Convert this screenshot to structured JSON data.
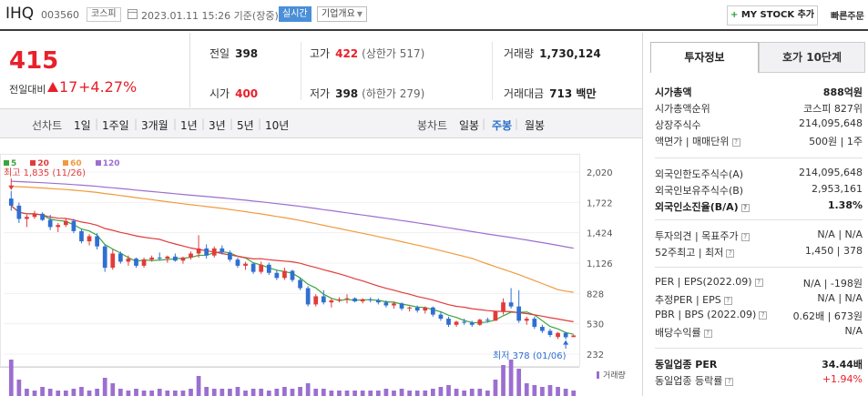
{
  "header": {
    "name": "IHQ",
    "code": "003560",
    "market": "코스피",
    "date_text": "2023.01.11 15:26 기준(장중)",
    "realtime_label": "실시간",
    "corp_label": "기업개요",
    "mystock_plus": "+",
    "mystock_label": "MY STOCK 추가",
    "quick_order": "빠른주문"
  },
  "price": {
    "current": "415",
    "change_label": "전일대비",
    "change_value": "17",
    "change_pct": "+4.27%"
  },
  "summary": {
    "prev_label": "전일",
    "prev": "398",
    "high_label": "고가",
    "high": "422",
    "high_note": "(상한가 517)",
    "volume_label": "거래량",
    "volume": "1,730,124",
    "open_label": "시가",
    "open": "400",
    "low_label": "저가",
    "low": "398",
    "low_note": "(하한가 279)",
    "amount_label": "거래대금",
    "amount": "713 백만"
  },
  "period_bar": {
    "line_label": "선차트",
    "line_periods": [
      "1일",
      "1주일",
      "3개월",
      "1년",
      "3년",
      "5년",
      "10년"
    ],
    "candle_label": "봉차트",
    "candle_periods": [
      "일봉",
      "주봉",
      "월봉"
    ],
    "candle_selected": "주봉"
  },
  "chart_data": {
    "type": "candlestick",
    "interval": "weekly",
    "y_ticks": [
      "2,020",
      "1,722",
      "1,424",
      "1,126",
      "828",
      "530",
      "232"
    ],
    "ylim": [
      232,
      2020
    ],
    "moving_averages": [
      {
        "name": "5",
        "color": "#3aa63a"
      },
      {
        "name": "20",
        "color": "#e23b3b"
      },
      {
        "name": "60",
        "color": "#f09a3e"
      },
      {
        "name": "120",
        "color": "#9b6fd0"
      }
    ],
    "high_annotation": "최고 1,835 (11/26)",
    "low_annotation": "최저 378 (01/06)",
    "volume_label": "거래량",
    "candles": [
      [
        1760,
        1835,
        1640,
        1690
      ],
      [
        1690,
        1720,
        1520,
        1560
      ],
      [
        1560,
        1600,
        1480,
        1580
      ],
      [
        1580,
        1640,
        1560,
        1610
      ],
      [
        1610,
        1625,
        1540,
        1550
      ],
      [
        1550,
        1600,
        1450,
        1480
      ],
      [
        1480,
        1520,
        1430,
        1500
      ],
      [
        1500,
        1560,
        1480,
        1540
      ],
      [
        1540,
        1560,
        1420,
        1440
      ],
      [
        1440,
        1460,
        1320,
        1340
      ],
      [
        1340,
        1410,
        1300,
        1390
      ],
      [
        1390,
        1420,
        1260,
        1290
      ],
      [
        1290,
        1310,
        1040,
        1080
      ],
      [
        1080,
        1260,
        1060,
        1220
      ],
      [
        1220,
        1240,
        1120,
        1140
      ],
      [
        1140,
        1200,
        1100,
        1170
      ],
      [
        1170,
        1180,
        1080,
        1100
      ],
      [
        1100,
        1180,
        1080,
        1160
      ],
      [
        1160,
        1200,
        1140,
        1180
      ],
      [
        1180,
        1230,
        1150,
        1170
      ],
      [
        1170,
        1200,
        1130,
        1190
      ],
      [
        1190,
        1220,
        1140,
        1150
      ],
      [
        1150,
        1190,
        1120,
        1180
      ],
      [
        1180,
        1240,
        1160,
        1220
      ],
      [
        1220,
        1400,
        1180,
        1270
      ],
      [
        1270,
        1310,
        1170,
        1200
      ],
      [
        1200,
        1290,
        1180,
        1270
      ],
      [
        1270,
        1300,
        1210,
        1230
      ],
      [
        1230,
        1250,
        1140,
        1160
      ],
      [
        1160,
        1180,
        1080,
        1100
      ],
      [
        1100,
        1140,
        1060,
        1120
      ],
      [
        1120,
        1130,
        1020,
        1040
      ],
      [
        1040,
        1140,
        1020,
        1110
      ],
      [
        1110,
        1130,
        1010,
        1030
      ],
      [
        1030,
        1060,
        960,
        980
      ],
      [
        980,
        1080,
        960,
        1050
      ],
      [
        1050,
        1060,
        940,
        960
      ],
      [
        960,
        980,
        860,
        880
      ],
      [
        880,
        900,
        700,
        720
      ],
      [
        720,
        820,
        700,
        800
      ],
      [
        800,
        860,
        720,
        740
      ],
      [
        740,
        780,
        690,
        760
      ],
      [
        760,
        790,
        740,
        770
      ],
      [
        770,
        820,
        730,
        780
      ],
      [
        780,
        790,
        740,
        750
      ],
      [
        750,
        780,
        730,
        770
      ],
      [
        770,
        790,
        740,
        760
      ],
      [
        760,
        780,
        720,
        740
      ],
      [
        740,
        760,
        690,
        710
      ],
      [
        710,
        750,
        680,
        730
      ],
      [
        730,
        740,
        660,
        680
      ],
      [
        680,
        700,
        650,
        690
      ],
      [
        690,
        710,
        640,
        660
      ],
      [
        660,
        700,
        630,
        690
      ],
      [
        690,
        700,
        600,
        620
      ],
      [
        620,
        650,
        560,
        580
      ],
      [
        580,
        600,
        500,
        520
      ],
      [
        520,
        560,
        500,
        550
      ],
      [
        550,
        580,
        520,
        540
      ],
      [
        540,
        560,
        500,
        520
      ],
      [
        520,
        580,
        510,
        570
      ],
      [
        570,
        590,
        540,
        560
      ],
      [
        560,
        660,
        560,
        650
      ],
      [
        650,
        780,
        620,
        740
      ],
      [
        740,
        880,
        680,
        700
      ],
      [
        700,
        860,
        540,
        560
      ],
      [
        560,
        600,
        520,
        580
      ],
      [
        580,
        600,
        480,
        500
      ],
      [
        500,
        520,
        440,
        460
      ],
      [
        460,
        480,
        400,
        420
      ],
      [
        400,
        450,
        380,
        440
      ],
      [
        440,
        450,
        378,
        398
      ],
      [
        400,
        422,
        398,
        415
      ]
    ]
  },
  "right_panel": {
    "tab_active": "투자정보",
    "tab_other": "호가 10단계",
    "rows": [
      {
        "k": "시가총액",
        "v": "888억원",
        "bold": true
      },
      {
        "k": "시가총액순위",
        "v": "코스피 827위"
      },
      {
        "k": "상장주식수",
        "v": "214,095,648"
      },
      {
        "k": "액면가 | 매매단위",
        "v": "500원 | 1주"
      },
      {
        "k": "외국인한도주식수(A)",
        "v": "214,095,648"
      },
      {
        "k": "외국인보유주식수(B)",
        "v": "2,953,161"
      },
      {
        "k": "외국인소진율(B/A)",
        "v": "1.38%",
        "bold": true
      },
      {
        "k": "투자의견 | 목표주가",
        "v": "N/A | N/A"
      },
      {
        "k": "52주최고 | 최저",
        "v": "1,450 | 378"
      },
      {
        "k": "PER | EPS(2022.09)",
        "v": "N/A | -198원"
      },
      {
        "k": "추정PER | EPS",
        "v": "N/A | N/A"
      },
      {
        "k": "PBR | BPS (2022.09)",
        "v": "0.62배 | 673원"
      },
      {
        "k": "배당수익률",
        "v": "N/A"
      },
      {
        "k": "동일업종 PER",
        "v": "34.44배",
        "bold": true
      },
      {
        "k": "동일업종 등락률",
        "v": "+1.94%"
      }
    ]
  }
}
